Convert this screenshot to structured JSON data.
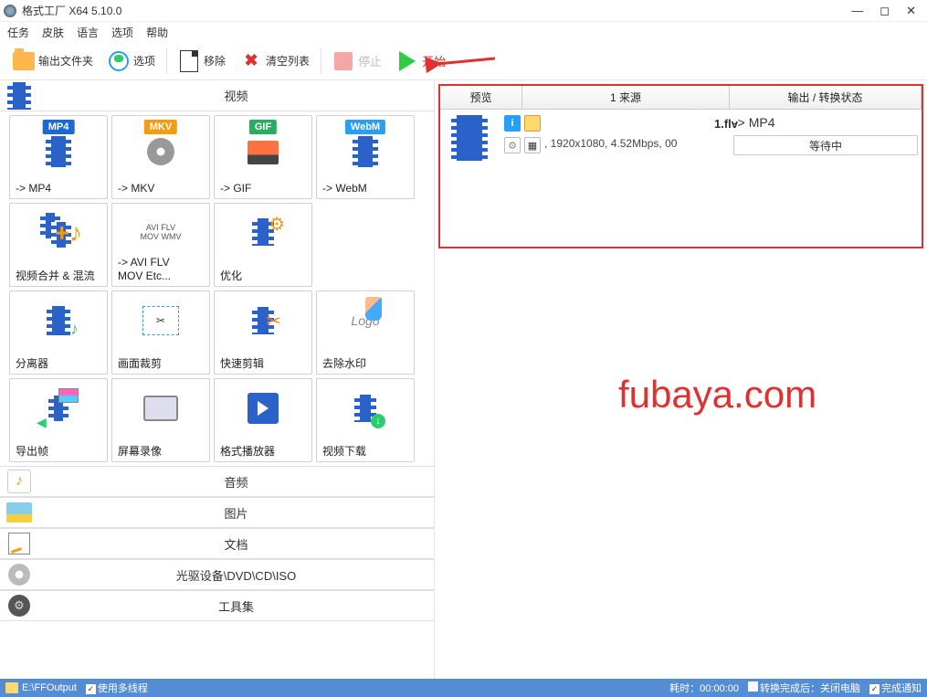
{
  "titlebar": {
    "title": "格式工厂 X64 5.10.0"
  },
  "menu": {
    "task": "任务",
    "skin": "皮肤",
    "lang": "语言",
    "options": "选项",
    "help": "帮助"
  },
  "toolbar": {
    "output_folder": "输出文件夹",
    "options": "选项",
    "remove": "移除",
    "clear_list": "清空列表",
    "stop": "停止",
    "start": "开始"
  },
  "categories": {
    "video": "视频",
    "audio": "音频",
    "image": "图片",
    "document": "文档",
    "disc": "光驱设备\\DVD\\CD\\ISO",
    "toolkit": "工具集"
  },
  "video_items": {
    "mp4": "-> MP4",
    "mkv": "-> MKV",
    "gif": "-> GIF",
    "webm": "-> WebM",
    "merge": "视频合并 & 混流",
    "avi_flv": "-> AVI FLV\nMOV Etc...",
    "optimize": "优化",
    "splitter": "分离器",
    "crop": "画面裁剪",
    "quickedit": "快速剪辑",
    "delogo": "去除水印",
    "export_frame": "导出帧",
    "screenrec": "屏幕录像",
    "player": "格式播放器",
    "download": "视频下载",
    "badges": {
      "mp4": "MP4",
      "mkv": "MKV",
      "gif": "GIF",
      "webm": "WebM"
    }
  },
  "right": {
    "headers": {
      "preview": "预览",
      "source": "1 来源",
      "status": "输出 / 转换状态"
    },
    "task": {
      "filename": "1.flv",
      "meta": ", 1920x1080, 4.52Mbps, 00",
      "target": "-> MP4",
      "status": "等待中"
    }
  },
  "watermark": "fubaya.com",
  "statusbar": {
    "output_path": "E:\\FFOutput",
    "multithread": "使用多线程",
    "elapsed": "耗时：00:00:00",
    "after_convert": "转换完成后：关闭电脑",
    "notify": "完成通知"
  }
}
